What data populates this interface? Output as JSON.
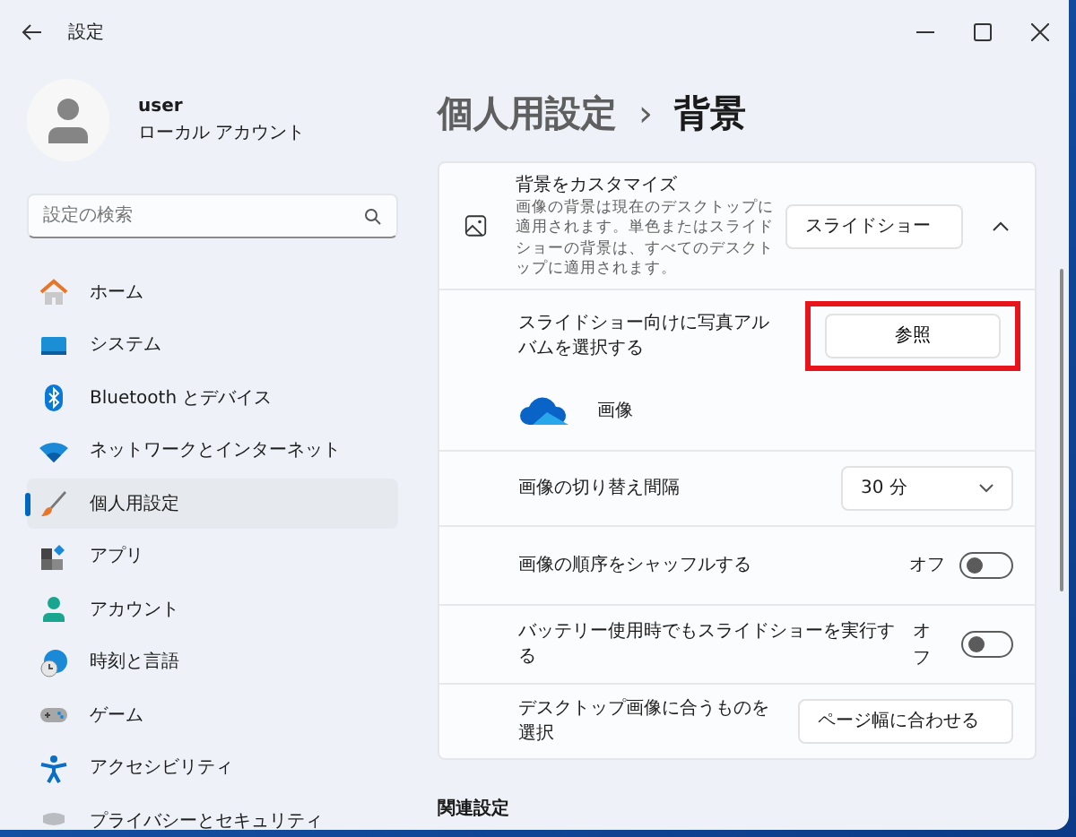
{
  "window": {
    "title": "設定"
  },
  "user": {
    "name": "user",
    "account": "ローカル アカウント"
  },
  "search": {
    "placeholder": "設定の検索"
  },
  "sidebar": {
    "items": [
      {
        "label": "ホーム",
        "selected": false
      },
      {
        "label": "システム",
        "selected": false
      },
      {
        "label": "Bluetooth とデバイス",
        "selected": false
      },
      {
        "label": "ネットワークとインターネット",
        "selected": false
      },
      {
        "label": "個人用設定",
        "selected": true
      },
      {
        "label": "アプリ",
        "selected": false
      },
      {
        "label": "アカウント",
        "selected": false
      },
      {
        "label": "時刻と言語",
        "selected": false
      },
      {
        "label": "ゲーム",
        "selected": false
      },
      {
        "label": "アクセシビリティ",
        "selected": false
      },
      {
        "label": "プライバシーとセキュリティ",
        "selected": false
      }
    ]
  },
  "breadcrumb": {
    "parent": "個人用設定",
    "separator": "›",
    "current": "背景"
  },
  "background": {
    "title": "背景をカスタマイズ",
    "description": "画像の背景は現在のデスクトップに適用されます。単色またはスライドショーの背景は、すべてのデスクトップに適用されます。",
    "value": "スライドショー",
    "expanded": true
  },
  "rows": [
    {
      "kind": "browse",
      "label": "スライドショー向けに写真アルバムを選択する",
      "button": "参照",
      "highlighted": true,
      "album": "画像"
    },
    {
      "kind": "select",
      "label": "画像の切り替え間隔",
      "value": "30 分"
    },
    {
      "kind": "toggle",
      "label": "画像の順序をシャッフルする",
      "state": "オフ",
      "on": false
    },
    {
      "kind": "toggle",
      "label": "バッテリー使用時でもスライドショーを実行する",
      "state": "オフ",
      "on": false
    },
    {
      "kind": "select",
      "label": "デスクトップ画像に合うものを選択",
      "value": "ページ幅に合わせる"
    }
  ],
  "related": {
    "title": "関連設定"
  }
}
